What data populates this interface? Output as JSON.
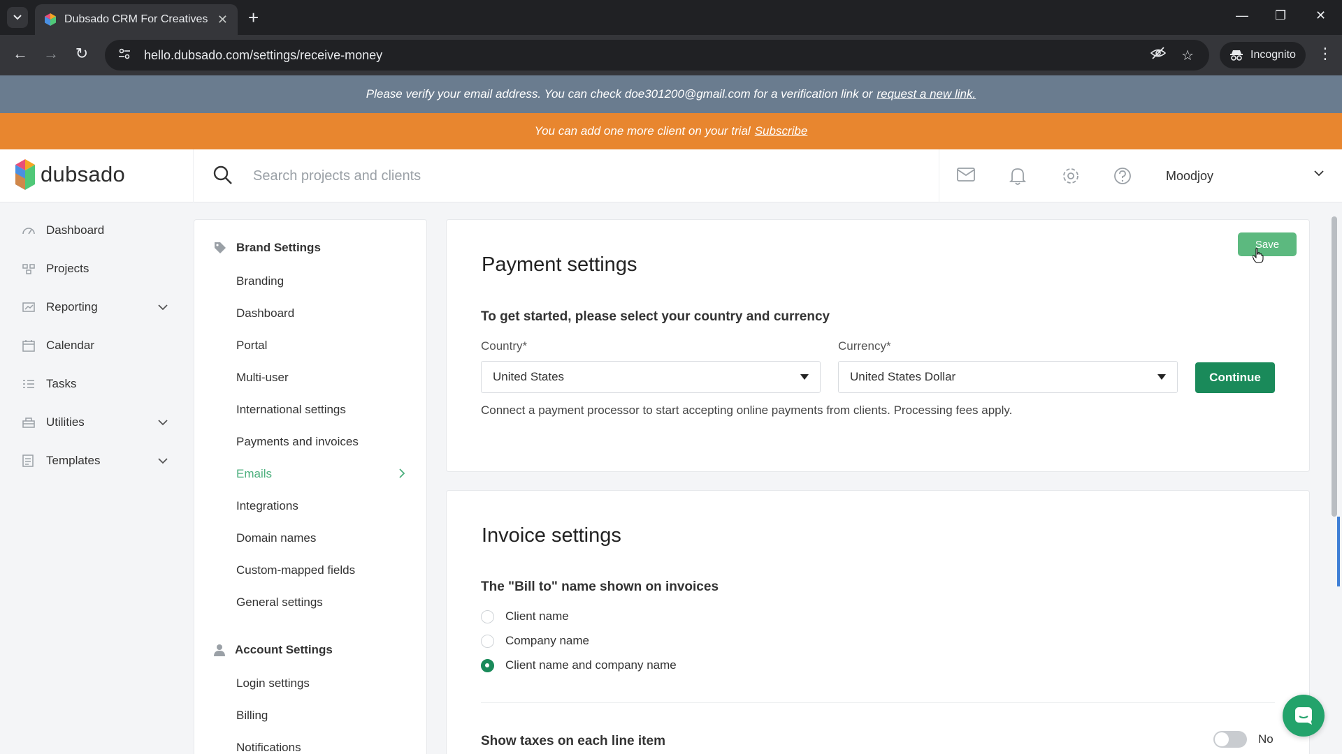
{
  "browser": {
    "tab_title": "Dubsado CRM For Creatives",
    "url": "hello.dubsado.com/settings/receive-money",
    "incognito_label": "Incognito"
  },
  "banners": {
    "verify_text": "Please verify your email address. You can check doe301200@gmail.com for a verification link or",
    "verify_link": "request a new link.",
    "trial_text": "You can add one more client on your trial",
    "trial_link": "Subscribe"
  },
  "header": {
    "logo_text": "dubsado",
    "search_placeholder": "Search projects and clients",
    "user_name": "Moodjoy"
  },
  "left_nav": {
    "items": [
      {
        "label": "Dashboard",
        "icon": "dashboard-icon"
      },
      {
        "label": "Projects",
        "icon": "projects-icon"
      },
      {
        "label": "Reporting",
        "icon": "reporting-icon"
      },
      {
        "label": "Calendar",
        "icon": "calendar-icon"
      },
      {
        "label": "Tasks",
        "icon": "tasks-icon"
      },
      {
        "label": "Utilities",
        "icon": "utilities-icon"
      },
      {
        "label": "Templates",
        "icon": "templates-icon"
      }
    ]
  },
  "settings_nav": {
    "brand_heading": "Brand Settings",
    "brand_items": [
      "Branding",
      "Dashboard",
      "Portal",
      "Multi-user",
      "International settings",
      "Payments and invoices",
      "Emails",
      "Integrations",
      "Domain names",
      "Custom-mapped fields",
      "General settings"
    ],
    "active_item": "Emails",
    "account_heading": "Account Settings",
    "account_items": [
      "Login settings",
      "Billing",
      "Notifications"
    ]
  },
  "payment": {
    "title": "Payment settings",
    "save_label": "Save",
    "intro": "To get started, please select your country and currency",
    "country_label": "Country*",
    "country_value": "United States",
    "currency_label": "Currency*",
    "currency_value": "United States Dollar",
    "continue_label": "Continue",
    "help_text": "Connect a payment processor to start accepting online payments from clients. Processing fees apply."
  },
  "invoice": {
    "title": "Invoice settings",
    "bill_to_label": "The \"Bill to\" name shown on invoices",
    "options": [
      "Client name",
      "Company name",
      "Client name and company name"
    ],
    "selected_option": "Client name and company name",
    "taxes_label": "Show taxes on each line item",
    "taxes_toggle_value": "No"
  },
  "colors": {
    "accent_green": "#1a8a5a",
    "save_green": "#5cb97f",
    "active_nav_green": "#4caf7d",
    "verify_banner": "#6a7c8f",
    "trial_banner": "#e8862f"
  }
}
